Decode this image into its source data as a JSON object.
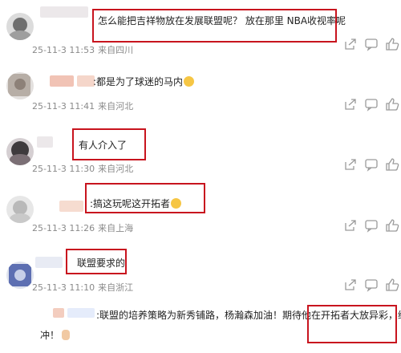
{
  "colors": {
    "highlight": "#c8141e",
    "meta_text": "#8a8a8a",
    "icon": "#9a9a9a"
  },
  "comments": [
    {
      "text": "怎么能把吉祥物放在发展联盟呢？ 放在那里 NBA收视率呢",
      "time": "25-11-3 11:53",
      "location": "来自四川",
      "actions": {
        "share": "share-icon",
        "comment": "comment-icon",
        "like": "like-icon"
      }
    },
    {
      "text": ":都是为了球迷的马内",
      "time": "25-11-3 11:41",
      "location": "来自河北"
    },
    {
      "text": "有人介入了",
      "time": "25-11-3 11:30",
      "location": "来自河北"
    },
    {
      "text": ":搞这玩呢这开拓者",
      "time": "25-11-3 11:26",
      "location": "来自上海"
    },
    {
      "text": "联盟要求的",
      "time": "25-11-3 11:10",
      "location": "来自浙江"
    }
  ],
  "reply": {
    "line1": ":联盟的培养策略为新秀铺路，杨瀚森加油！期待他在开拓者大放异彩，继续",
    "line2": "冲！"
  }
}
